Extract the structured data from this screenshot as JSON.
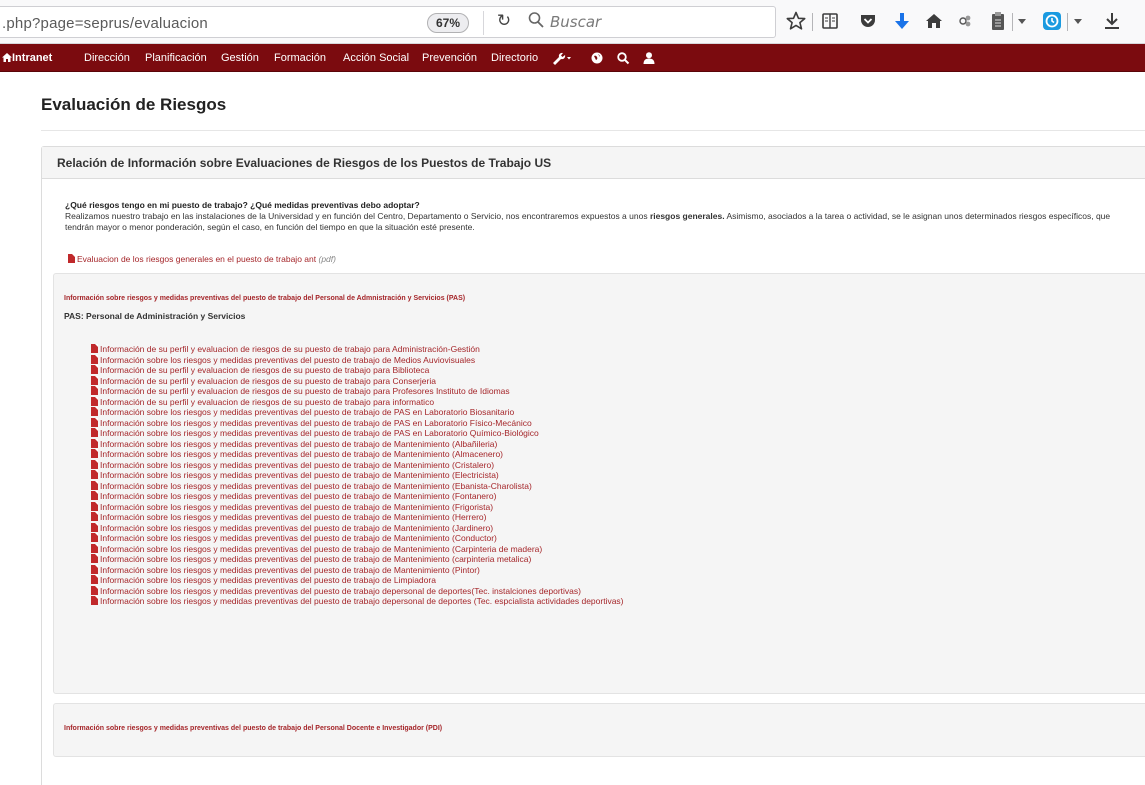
{
  "browser": {
    "url": ".php?page=seprus/evaluacion",
    "zoom": "67%",
    "search_placeholder": "Buscar",
    "toolbar_icons": [
      "star-icon",
      "reader-icon",
      "pocket-icon",
      "download-arrow-icon",
      "home-icon",
      "extension-icon",
      "clipboard-icon",
      "menu-caret-icon",
      "download-clock-icon",
      "menu-caret-icon",
      "download-icon"
    ]
  },
  "nav": {
    "brand": "Intranet",
    "items": [
      "Dirección",
      "Planificación",
      "Gestión",
      "Formación",
      "Acción Social",
      "Prevención",
      "Directorio"
    ],
    "tool_icons": [
      "wrench-icon",
      "globe-icon",
      "search-icon",
      "user-icon"
    ],
    "color": "#7b0b0f"
  },
  "page": {
    "title": "Evaluación de Riesgos"
  },
  "panel": {
    "title": "Relación de Información sobre Evaluaciones de Riesgos de los Puestos de Trabajo US",
    "question": "¿Qué riesgos tengo en mi puesto de trabajo? ¿Qué medidas preventivas debo adoptar?",
    "body_before": "Realizamos nuestro trabajo en las instalaciones de la Universidad y en función del Centro, Departamento o Servicio, nos encontraremos expuestos a unos ",
    "body_bold": "riesgos generales.",
    "body_after": " Asimismo, asociados a la tarea o actividad, se le asignan unos determinados riesgos específicos, que tendrán mayor o menor ponderación, según el caso, en función del tiempo en que la situación esté presente.",
    "general_link": "Evaluacion de los riesgos generales en el puesto de trabajo ant",
    "general_link_note": "(pdf)"
  },
  "pas": {
    "header": "Información sobre riesgos y medidas preventivas del puesto de trabajo del Personal de Admnistración y Servicios (PAS)",
    "subtitle": "PAS: Personal de Administración y Servicios",
    "links": [
      "Información de su perfil y evaluacion de riesgos de su puesto de trabajo para Administración-Gestión",
      "Información sobre los riesgos y medidas preventivas del puesto de trabajo de Medios Auviovisuales",
      "Información de su perfil y evaluacion de riesgos de su puesto de trabajo para Biblioteca",
      "Información de su perfil y evaluacion de riesgos de su puesto de trabajo para Conserjeria",
      "Información de su perfil y evaluacion de riesgos de su puesto de trabajo para Profesores Instituto de Idiomas",
      "Información de su perfil y evaluacion de riesgos de su puesto de trabajo para informatico",
      "Información sobre los riesgos y medidas preventivas del puesto de trabajo de PAS en Laboratorio Biosanitario",
      "Información sobre los riesgos y medidas preventivas del puesto de trabajo de PAS en Laboratorio Físico-Mecánico",
      "Información sobre los riesgos y medidas preventivas del puesto de trabajo de PAS en Laboratorio Químico-Biológico",
      "Información sobre los riesgos y medidas preventivas del puesto de trabajo de Mantenimiento (Albañileria)",
      "Información sobre los riesgos y medidas preventivas del puesto de trabajo de Mantenimiento (Almacenero)",
      "Información sobre los riesgos y medidas preventivas del puesto de trabajo de Mantenimiento (Cristalero)",
      "Información sobre los riesgos y medidas preventivas del puesto de trabajo de Mantenimiento (Electricista)",
      "Información sobre los riesgos y medidas preventivas del puesto de trabajo de Mantenimiento (Ebanista-Charolista)",
      "Información sobre los riesgos y medidas preventivas del puesto de trabajo de Mantenimiento (Fontanero)",
      "Información sobre los riesgos y medidas preventivas del puesto de trabajo de Mantenimiento (Frigorista)",
      "Información sobre los riesgos y medidas preventivas del puesto de trabajo de Mantenimiento (Herrero)",
      "Información sobre los riesgos y medidas preventivas del puesto de trabajo de Mantenimiento (Jardinero)",
      "Información sobre los riesgos y medidas preventivas del puesto de trabajo de Mantenimiento (Conductor)",
      "Información sobre los riesgos y medidas preventivas del puesto de trabajo de Mantenimiento (Carpinteria de madera)",
      "Información sobre los riesgos y medidas preventivas del puesto de trabajo de Mantenimiento (carpinteria metalica)",
      "Información sobre los riesgos y medidas preventivas del puesto de trabajo de Mantenimiento (Pintor)",
      "Información sobre los riesgos y medidas preventivas del puesto de trabajo de Limpiadora",
      "Información sobre los riesgos y medidas preventivas del puesto de trabajo depersonal de deportes(Tec. instalciones deportivas)",
      "Información sobre los riesgos y medidas preventivas del puesto de trabajo depersonal de deportes (Tec. espcialista actividades deportivas)"
    ]
  },
  "pdi": {
    "header": "Información sobre riesgos y medidas preventivas del puesto de trabajo del Personal Docente e Investigador (PDI)"
  },
  "colors": {
    "link": "#a5262a",
    "nav_bg": "#7b0b0f",
    "well_bg": "#f5f5f5"
  }
}
